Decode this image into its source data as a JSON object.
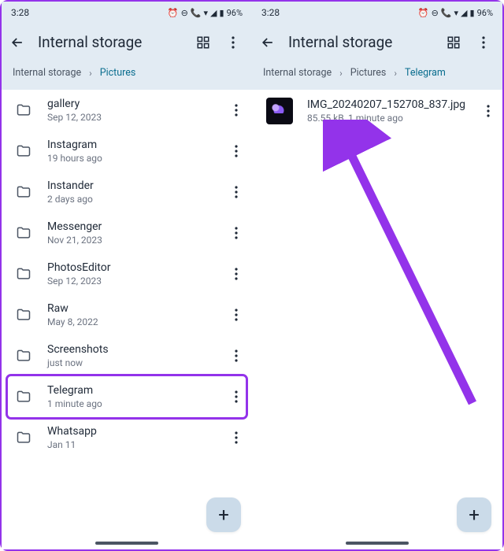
{
  "status": {
    "time": "3:28",
    "battery": "96%"
  },
  "left": {
    "title": "Internal storage",
    "breadcrumb": [
      "Internal storage",
      "Pictures"
    ],
    "folders": [
      {
        "name": "gallery",
        "sub": "Sep 12, 2023"
      },
      {
        "name": "Instagram",
        "sub": "19 hours ago"
      },
      {
        "name": "Instander",
        "sub": "2 days ago"
      },
      {
        "name": "Messenger",
        "sub": "Nov 21, 2023"
      },
      {
        "name": "PhotosEditor",
        "sub": "Sep 12, 2023"
      },
      {
        "name": "Raw",
        "sub": "May 8, 2022"
      },
      {
        "name": "Screenshots",
        "sub": "just now"
      },
      {
        "name": "Telegram",
        "sub": "1 minute ago",
        "highlight": true
      },
      {
        "name": "Whatsapp",
        "sub": "Jan 11"
      }
    ]
  },
  "right": {
    "title": "Internal storage",
    "breadcrumb": [
      "Internal storage",
      "Pictures",
      "Telegram"
    ],
    "files": [
      {
        "name": "IMG_20240207_152708_837.jpg",
        "sub": "85.55 kB, 1 minute ago"
      }
    ]
  },
  "icons": {
    "grid": "grid-icon",
    "more": "more-icon",
    "back": "back-icon",
    "folder": "folder-icon",
    "plus": "+"
  }
}
